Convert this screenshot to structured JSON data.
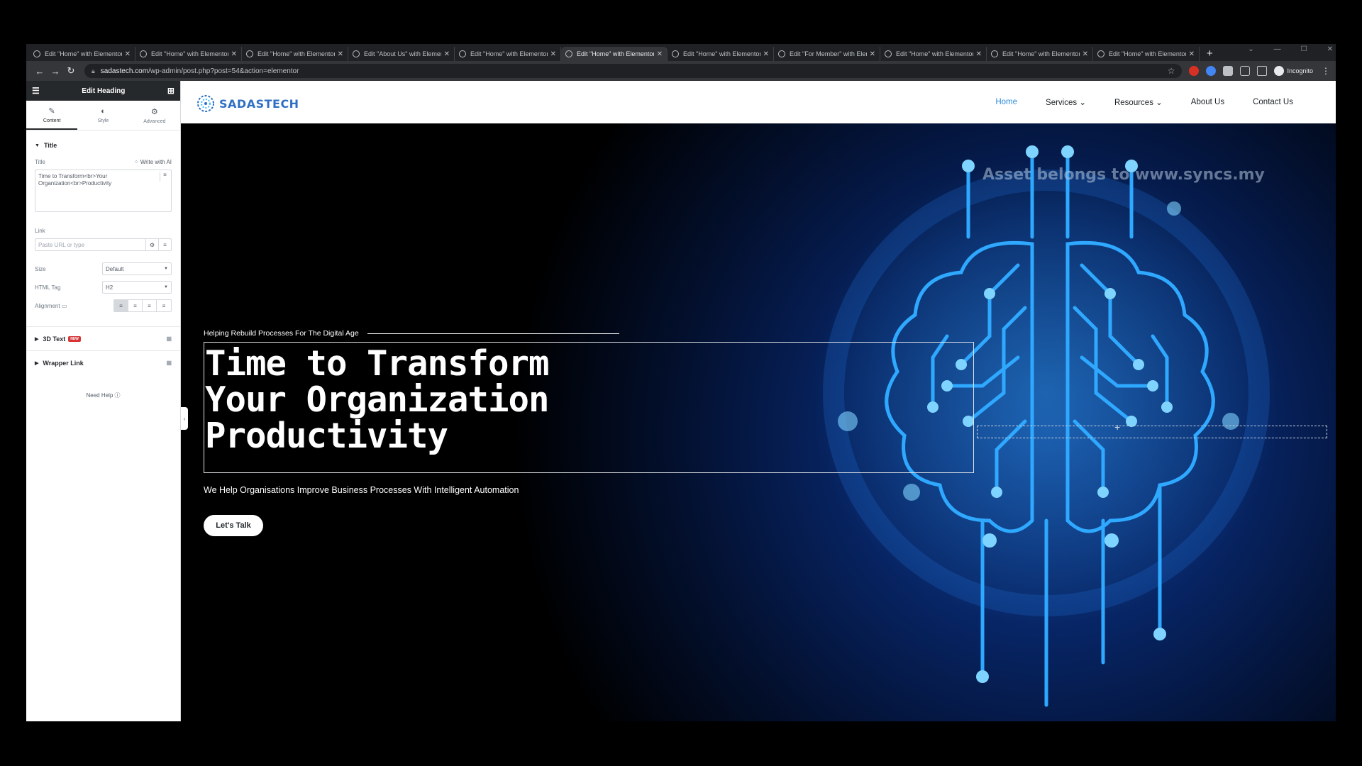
{
  "browser": {
    "tabs": [
      {
        "title": "Edit \"Home\" with Elementor",
        "active": false
      },
      {
        "title": "Edit \"Home\" with Elementor",
        "active": false
      },
      {
        "title": "Edit \"Home\" with Elementor",
        "active": false
      },
      {
        "title": "Edit \"About Us\" with Elementor",
        "active": false
      },
      {
        "title": "Edit \"Home\" with Elementor",
        "active": false
      },
      {
        "title": "Edit \"Home\" with Elementor",
        "active": true
      },
      {
        "title": "Edit \"Home\" with Elementor",
        "active": false
      },
      {
        "title": "Edit \"For Member\" with Elementor",
        "active": false
      },
      {
        "title": "Edit \"Home\" with Elementor",
        "active": false
      },
      {
        "title": "Edit \"Home\" with Elementor",
        "active": false
      },
      {
        "title": "Edit \"Home\" with Elementor",
        "active": false
      }
    ],
    "url_host": "sadastech.com",
    "url_path": "/wp-admin/post.php?post=54&action=elementor",
    "profile": "Incognito"
  },
  "panel": {
    "header_title": "Edit Heading",
    "tabs": [
      "Content",
      "Style",
      "Advanced"
    ],
    "section_title": "Title",
    "title_label": "Title",
    "write_ai": "Write with AI",
    "title_value": "Time to Transform<br>Your Organization<br>Productivity",
    "link_label": "Link",
    "link_placeholder": "Paste URL or type",
    "size_label": "Size",
    "size_value": "Default",
    "html_tag_label": "HTML Tag",
    "html_tag_value": "H2",
    "alignment_label": "Alignment",
    "section_3d_text": "3D Text",
    "badge_new": "NEW",
    "section_wrapper_link": "Wrapper Link",
    "need_help": "Need Help"
  },
  "site": {
    "logo_text": "SADASTECH",
    "nav": [
      "Home",
      "Services",
      "Resources",
      "About Us",
      "Contact Us"
    ],
    "nav_active": "Home",
    "watermark": "Asset belongs to www.syncs.my",
    "kicker": "Helping Rebuild Processes For The Digital Age",
    "headline": [
      "Time to Transform",
      "Your Organization",
      "Productivity"
    ],
    "subhead": "We Help Organisations Improve Business Processes With Intelligent Automation",
    "cta": "Let's Talk"
  },
  "colors": {
    "accent_blue": "#2a8ad9",
    "panel_header": "#26292c",
    "glow": "#3ab7ff"
  }
}
